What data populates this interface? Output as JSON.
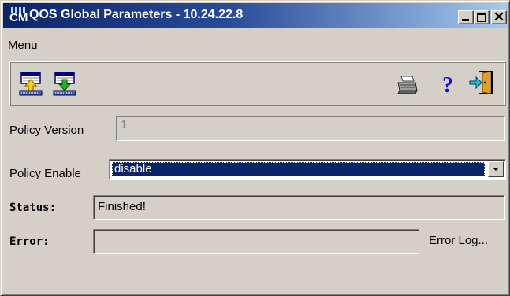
{
  "window": {
    "title": "QOS Global Parameters - 10.24.22.8",
    "app_icon_text": "CM"
  },
  "menu": {
    "label": "Menu"
  },
  "toolbar": {
    "upload_icon": "upload-to-device-icon",
    "download_icon": "download-from-device-icon",
    "print_icon": "printer-icon",
    "help_icon": "help-icon",
    "help_glyph": "?",
    "exit_icon": "exit-door-icon"
  },
  "form": {
    "policy_version_label": "Policy Version",
    "policy_version_value": "1",
    "policy_enable_label": "Policy Enable",
    "policy_enable_value": "disable",
    "status_label": "Status:",
    "status_value": "Finished!",
    "error_label": "Error:",
    "error_value": "",
    "error_log_label": "Error Log..."
  },
  "colors": {
    "titlebar_start": "#0a246a",
    "titlebar_end": "#a6caf0",
    "face": "#d4d0c8",
    "selection": "#0a246a"
  }
}
